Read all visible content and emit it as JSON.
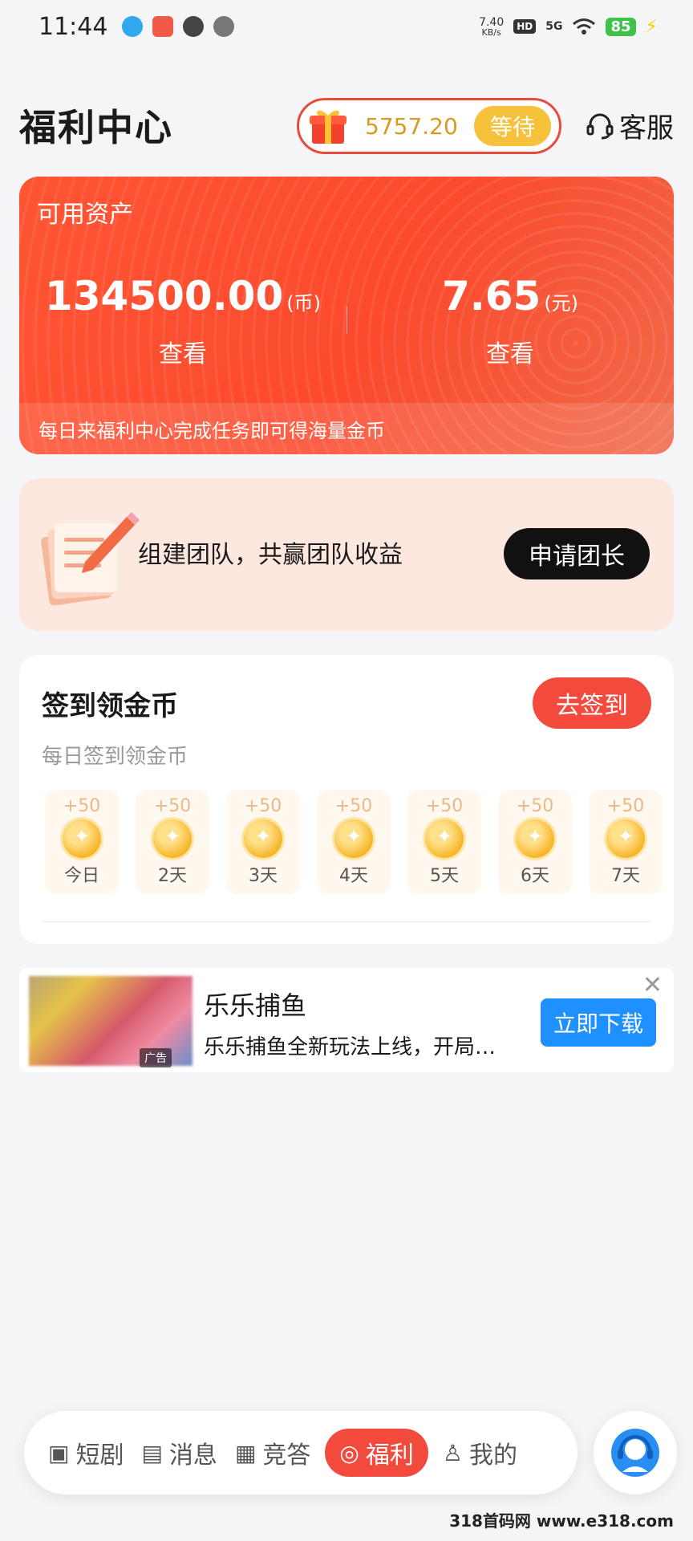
{
  "status_bar": {
    "time": "11:44",
    "net_speed": "7.40",
    "net_unit": "KB/s",
    "hd": "HD",
    "signal": "5G",
    "battery": "85"
  },
  "header": {
    "title": "福利中心",
    "pending_amount": "5757.20",
    "wait_label": "等待",
    "service_label": "客服"
  },
  "assets": {
    "label": "可用资产",
    "coins_value": "134500.00",
    "coins_unit": "(币)",
    "cash_value": "7.65",
    "cash_unit": "(元)",
    "view_label_left": "查看",
    "view_label_right": "查看",
    "tip": "每日来福利中心完成任务即可得海量金币"
  },
  "team": {
    "text": "组建团队，共赢团队收益",
    "button": "申请团长"
  },
  "checkin": {
    "title": "签到领金币",
    "subtitle": "每日签到领金币",
    "button": "去签到",
    "days": [
      {
        "bonus": "+50",
        "label": "今日"
      },
      {
        "bonus": "+50",
        "label": "2天"
      },
      {
        "bonus": "+50",
        "label": "3天"
      },
      {
        "bonus": "+50",
        "label": "4天"
      },
      {
        "bonus": "+50",
        "label": "5天"
      },
      {
        "bonus": "+50",
        "label": "6天"
      },
      {
        "bonus": "+50",
        "label": "7天"
      }
    ]
  },
  "ad": {
    "tag": "广告",
    "title": "乐乐捕鱼",
    "desc": "乐乐捕鱼全新玩法上线，开局…",
    "button": "立即下载",
    "close": "✕"
  },
  "nav": {
    "items": [
      {
        "label": "短剧",
        "icon": "video-icon"
      },
      {
        "label": "消息",
        "icon": "message-icon"
      },
      {
        "label": "竞答",
        "icon": "quiz-icon"
      },
      {
        "label": "福利",
        "icon": "welfare-icon"
      },
      {
        "label": "我的",
        "icon": "profile-icon"
      }
    ],
    "active": "福利"
  },
  "watermark": "318首码网 www.e318.com",
  "colors": {
    "accent_red": "#f24a3d",
    "gold": "#f6c13b",
    "download_blue": "#1e90ff"
  }
}
